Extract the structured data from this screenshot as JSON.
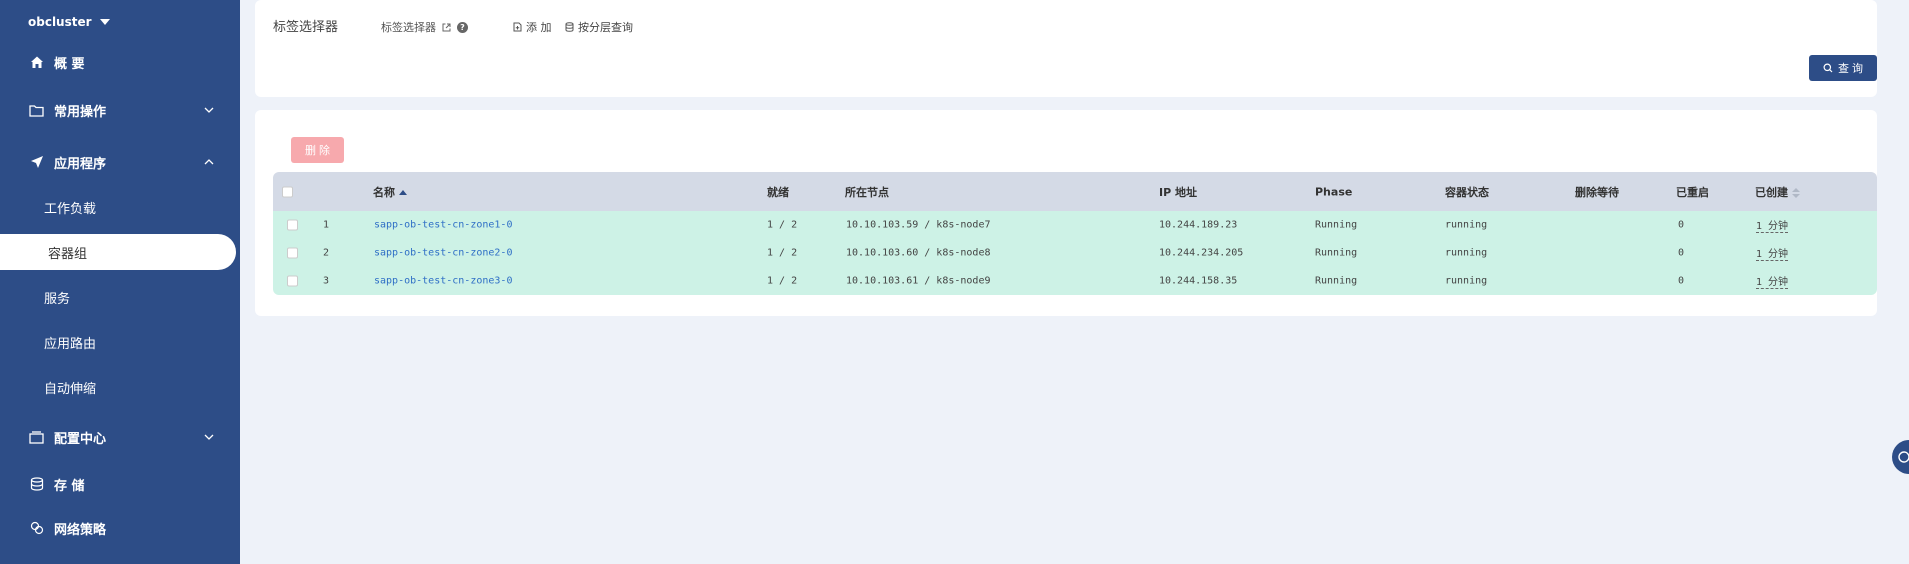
{
  "sidebar": {
    "cluster": "obcluster",
    "items": [
      {
        "label": "概 要",
        "icon": "home-icon"
      },
      {
        "label": "常用操作",
        "icon": "folder-icon"
      },
      {
        "label": "应用程序",
        "icon": "send-icon"
      },
      {
        "label": "配置中心",
        "icon": "config-icon"
      },
      {
        "label": "存 储",
        "icon": "storage-icon"
      },
      {
        "label": "网络策略",
        "icon": "network-icon"
      }
    ],
    "subitems": [
      "工作负载",
      "容器组",
      "服务",
      "应用路由",
      "自动伸缩"
    ]
  },
  "filter": {
    "title": "标签选择器",
    "selector_label": "标签选择器",
    "help": "?",
    "add_label": "添 加",
    "layer_query_label": "按分层查询",
    "query_button": "查 询"
  },
  "table": {
    "delete_button": "删 除",
    "columns": [
      "名称",
      "就绪",
      "所在节点",
      "IP 地址",
      "Phase",
      "容器状态",
      "删除等待",
      "已重启",
      "已创建"
    ],
    "rows": [
      {
        "index": "1",
        "name": "sapp-ob-test-cn-zone1-0",
        "ready": "1 / 2",
        "node": "10.10.103.59 / k8s-node7",
        "ip": "10.244.189.23",
        "phase": "Running",
        "status": "running",
        "pending": "",
        "restarts": "0",
        "created": "1 分钟"
      },
      {
        "index": "2",
        "name": "sapp-ob-test-cn-zone2-0",
        "ready": "1 / 2",
        "node": "10.10.103.60 / k8s-node8",
        "ip": "10.244.234.205",
        "phase": "Running",
        "status": "running",
        "pending": "",
        "restarts": "0",
        "created": "1 分钟"
      },
      {
        "index": "3",
        "name": "sapp-ob-test-cn-zone3-0",
        "ready": "1 / 2",
        "node": "10.10.103.61 / k8s-node9",
        "ip": "10.244.158.35",
        "phase": "Running",
        "status": "running",
        "pending": "",
        "restarts": "0",
        "created": "1 分钟"
      }
    ]
  },
  "colors": {
    "sidebar": "#2d4d87",
    "row_bg": "#cdf2e6",
    "header_bg": "#d4dae6",
    "delete_btn": "#f7a9ad",
    "link": "#2f6fc6"
  }
}
